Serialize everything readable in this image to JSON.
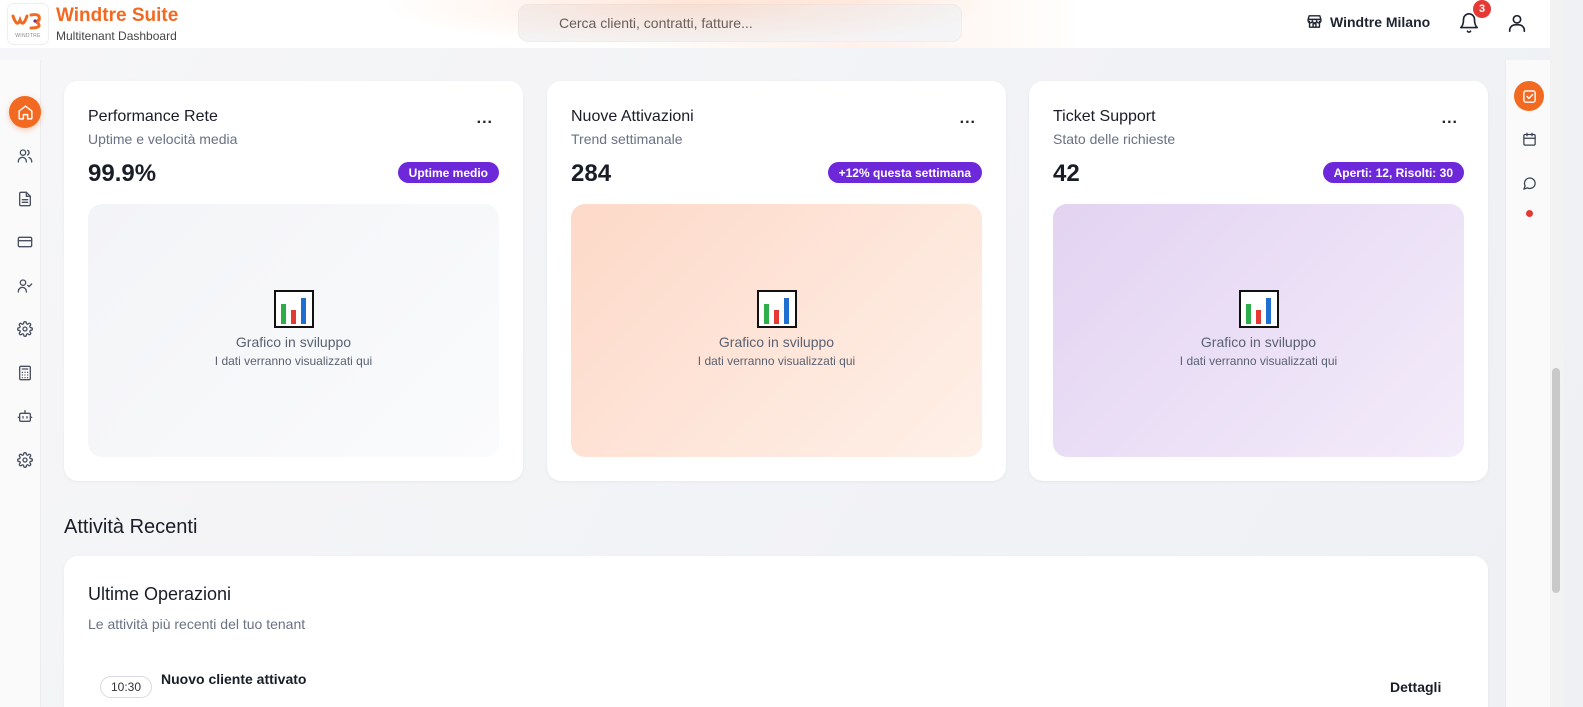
{
  "header": {
    "brand_title": "Windtre Suite",
    "brand_subtitle": "Multitenant Dashboard",
    "logo_caption": "WINDTRE",
    "search_placeholder": "Cerca clienti, contratti, fatture...",
    "tenant_name": "Windtre Milano",
    "notification_count": "3"
  },
  "sidebar": {
    "items": [
      {
        "icon": "home-icon",
        "active": true
      },
      {
        "icon": "users-icon"
      },
      {
        "icon": "document-icon"
      },
      {
        "icon": "credit-card-icon"
      },
      {
        "icon": "user-check-icon"
      },
      {
        "icon": "gear-icon"
      },
      {
        "icon": "calculator-icon"
      },
      {
        "icon": "bot-icon"
      },
      {
        "icon": "settings-icon"
      }
    ]
  },
  "rail": {
    "items": [
      {
        "icon": "task-check-icon",
        "active": true
      },
      {
        "icon": "calendar-icon"
      },
      {
        "icon": "chat-icon"
      }
    ]
  },
  "cards": [
    {
      "title": "Performance Rete",
      "subtitle": "Uptime e velocità media",
      "value": "99.9%",
      "badge": "Uptime medio",
      "chart_title": "Grafico in sviluppo",
      "chart_subtitle": "I dati verranno visualizzati qui"
    },
    {
      "title": "Nuove Attivazioni",
      "subtitle": "Trend settimanale",
      "value": "284",
      "badge": "+12% questa settimana",
      "chart_title": "Grafico in sviluppo",
      "chart_subtitle": "I dati verranno visualizzati qui"
    },
    {
      "title": "Ticket Support",
      "subtitle": "Stato delle richieste",
      "value": "42",
      "badge": "Aperti: 12, Risolti: 30",
      "chart_title": "Grafico in sviluppo",
      "chart_subtitle": "I dati verranno visualizzati qui"
    }
  ],
  "more_label": "...",
  "recent": {
    "section_title": "Attività Recenti",
    "panel_title": "Ultime Operazioni",
    "panel_subtitle": "Le attività più recenti del tuo tenant",
    "operations": [
      {
        "time": "10:30",
        "title": "Nuovo cliente attivato",
        "action": "Dettagli"
      }
    ]
  },
  "colors": {
    "accent": "#f26a21",
    "badge_purple": "#6d28d9",
    "notification_red": "#e53935"
  }
}
